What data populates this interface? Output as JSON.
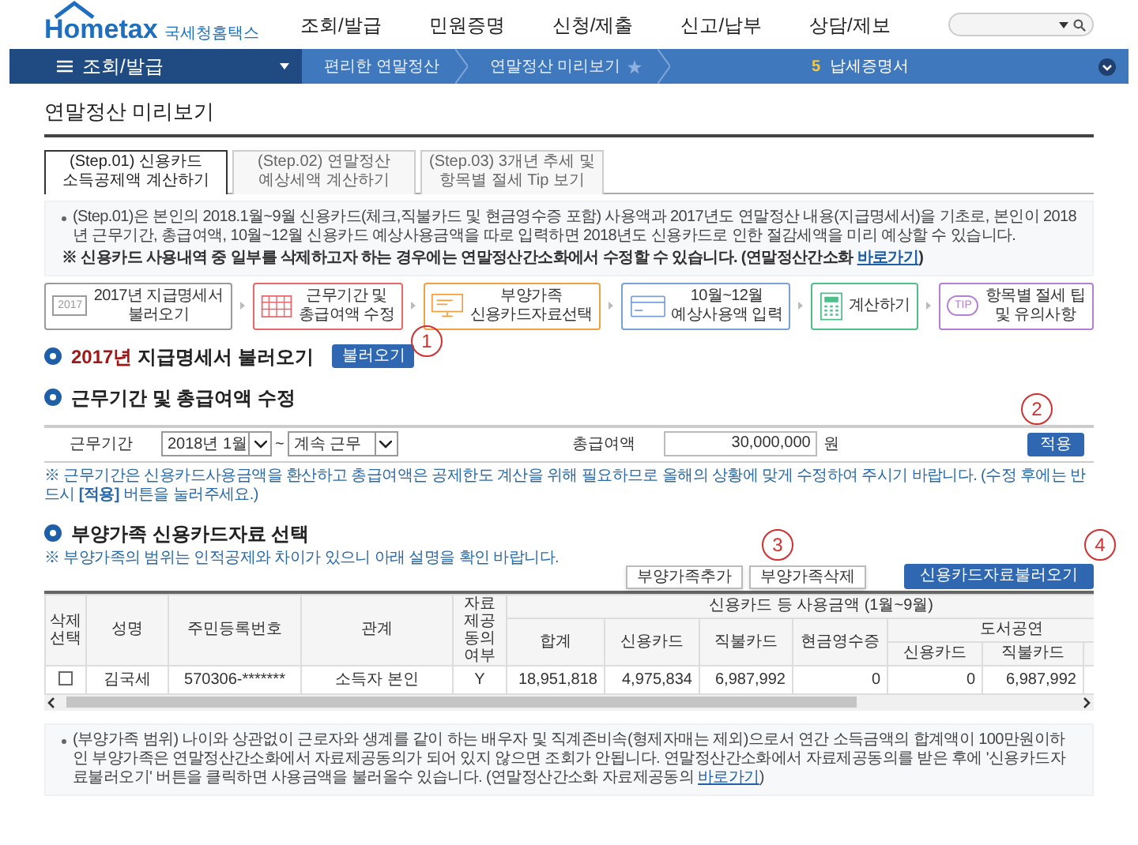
{
  "header": {
    "logo": "Hometax",
    "logo_subtitle": "국세청홈택스",
    "nav": [
      "조회/발급",
      "민원증명",
      "신청/제출",
      "신고/납부",
      "상담/제보"
    ]
  },
  "menu_bar": {
    "menu": "조회/발급",
    "crumbs": [
      {
        "label": "편리한 연말정산",
        "favorite": false
      },
      {
        "label": "연말정산 미리보기",
        "favorite": true
      }
    ],
    "badge": "5",
    "shortcut": "납세증명서"
  },
  "page_title": "연말정산 미리보기",
  "tabs": [
    {
      "line1": "(Step.01) 신용카드",
      "line2": "소득공제액 계산하기",
      "selected": true
    },
    {
      "line1": "(Step.02) 연말정산",
      "line2": "예상세액 계산하기",
      "selected": false
    },
    {
      "line1": "(Step.03) 3개년 추세 및",
      "line2": "항목별 절세 Tip 보기",
      "selected": false
    }
  ],
  "intro": {
    "lines": [
      "(Step.01)은 본인의 2018.1월~9월 신용카드(체크,직불카드 및 현금영수증 포함) 사용액과 2017년도 연말정산 내용(지급명세서)을 기초로,",
      "본인이 2018년 근무기간, 총급여액, 10월~12월 신용카드 예상사용금액을 따로 입력하면 2018년도 신용카드로 인한 절감세액을 미리 예상할 수 있습니다."
    ],
    "note": "※ 신용카드 사용내역 중 일부를 삭제하고자 하는 경우에는 연말정산간소화에서 수정할 수 있습니다. (연말정산간소화 ",
    "link": "바로가기",
    "note_end": ")"
  },
  "steps": [
    {
      "line1": "2017년 지급명세서",
      "line2": "불러오기",
      "kind": "document",
      "icon_label": "2017",
      "color": "#9a9a9a"
    },
    {
      "line1": "근무기간 및",
      "line2": "총급여액 수정",
      "kind": "calendar",
      "color": "#e8676b"
    },
    {
      "line1": "부양가족",
      "line2": "신용카드자료선택",
      "kind": "monitor",
      "color": "#f0a040"
    },
    {
      "line1": "10월~12월",
      "line2": "예상사용액 입력",
      "kind": "card",
      "color": "#7aa0d8"
    },
    {
      "line1": "계산하기",
      "kind": "calculator",
      "color": "#4fbf8a"
    },
    {
      "line1": "항목별 절세 팁",
      "line2": "및 유의사항",
      "kind": "tip",
      "icon_label": "TIP",
      "color": "#b57fd6"
    }
  ],
  "section1": {
    "highlight": "2017년",
    "title": " 지급명세서 불러오기",
    "button": "불러오기",
    "marker": "1"
  },
  "section2": {
    "title": "근무기간 및 총급여액 수정",
    "period_label": "근무기간",
    "period_from": "2018년 1월",
    "separator": "~",
    "period_to": "계속 근무",
    "salary_label": "총급여액",
    "salary": "30,000,000",
    "unit": "원",
    "button": "적용",
    "marker": "2",
    "note": "※ 근무기간은 신용카드사용금액을 환산하고 총급여액은 공제한도 계산을 위해 필요하므로 올해의 상황에 맞게 수정하여 주시기 바랍니다. (수정 후에는 반드시 **[적용]** 버튼을 눌러주세요.)"
  },
  "section3": {
    "title": "부양가족 신용카드자료 선택",
    "note": "※ 부양가족의 범위는 인적공제와 차이가 있으니 아래 설명을 확인 바랍니다.",
    "buttons": [
      {
        "label": "부양가족추가",
        "kind": "plain",
        "marker": "3"
      },
      {
        "label": "부양가족삭제",
        "kind": "plain"
      },
      {
        "label": "신용카드자료불러오기",
        "kind": "primary",
        "marker": "4"
      }
    ]
  },
  "table": {
    "select_column": "삭제\n선택",
    "columns": [
      "성명",
      "주민등록번호",
      "관계",
      "자료\n제공\n동의\n여부"
    ],
    "group": "신용카드 등 사용금액 (1월~9월)",
    "subcolumns": [
      "합계",
      "신용카드",
      "직불카드",
      "현금영수증"
    ],
    "subgroup": "도서공연",
    "subgroup_columns": [
      "신용카드",
      "직불카드"
    ],
    "rows": [
      {
        "checked": false,
        "cells": [
          "김국세",
          "570306-*******",
          "소득자 본인",
          "Y",
          "18,951,818",
          "4,975,834",
          "6,987,992",
          "0",
          "0",
          "6,987,992"
        ]
      }
    ]
  },
  "footer_note": {
    "lines": [
      "(부양가족 범위) 나이와 상관없이 근로자와 생계를 같이 하는 배우자 및 직계존비속(형제자매는 제외)으로서 연간 소득금액의 합계액이 100만원이하인 부양가족은",
      "연말정산간소화에서 자료제공동의가 되어 있지 않으면 조회가 안됩니다. 연말정산간소화에서 자료제공동의를 받은 후에"
    ],
    "last": "'신용카드자료불러오기' 버튼을 클릭하면 사용금액을 불러올수 있습니다. (연말정산간소화 자료제공동의 ",
    "link": "바로가기",
    "last_end": ")"
  }
}
